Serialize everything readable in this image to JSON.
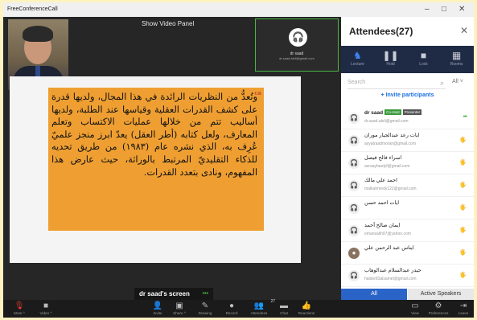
{
  "window": {
    "title": "FreeConferenceCall",
    "minimize": "–",
    "maximize": "□",
    "close": "✕"
  },
  "stage": {
    "show_video_panel": "Show Video Panel",
    "participant_tile": {
      "name": "dr saad",
      "email": "dr.saad.aleli@gmail.com"
    },
    "slide_corner_mark": "GR",
    "slide_text": "وتُعدُّ من النظريات الرائدة في هذا المجال، ولديها قدرة على كشف القدرات العقلية وقياسها عند الطلبة، ولديها أساليب تتم من خلالها عمليات الاكتساب وتعلم المعارف، ولعل كتابه (أطر العقل) يعدّ ابرز منجز علميّ عُرِف به، الذي نشره عام (١٩٨٣) من طريق تحديه للذكاء التقليديّ المرتبط بالوراثة، حيث عارض هذا المفهوم، ونادى بتعدد القدرات.",
    "screen_label": "dr saad's screen",
    "screen_indicator": "•••"
  },
  "sidebar": {
    "title": "Attendees(27)",
    "close": "✕",
    "tools": [
      {
        "label": "Lecture",
        "icon": "lecture-icon",
        "glyph": "♞"
      },
      {
        "label": "Hold",
        "icon": "pause-icon",
        "glyph": "❚❚"
      },
      {
        "label": "Lock",
        "icon": "lock-icon",
        "glyph": "■"
      },
      {
        "label": "Rooms",
        "icon": "grid-icon",
        "glyph": "▦"
      }
    ],
    "search_placeholder": "Search",
    "search_icon": "⌕",
    "filter": "All ˅",
    "invite": "+ Invite participants",
    "attendees": [
      {
        "name": "dr saad",
        "email": "dr.saad.aleli@gmail.com",
        "cohost": "Co-Host",
        "presenter": "Presenter",
        "right": "•••",
        "photo": false
      },
      {
        "name": "ايات رعد عبدالجبار موران",
        "email": "ayyatraadmoran@gmail.com",
        "right": "🖐",
        "photo": false
      },
      {
        "name": "اسراء فالح فيصل",
        "email": "asraayfaadyf@gmail.com",
        "right": "🖐",
        "photo": false
      },
      {
        "name": "احمد علي مالك",
        "email": "malkahmedy122@gmail.com",
        "right": "🖐",
        "photo": false
      },
      {
        "name": "ايات احمد حسن",
        "email": "",
        "right": "🖐",
        "photo": false
      },
      {
        "name": "ايمان صالح أحمد",
        "email": "emansalih97@yahoo.com",
        "right": "🖐",
        "photo": false
      },
      {
        "name": "ايناس عبد الرحمن علي",
        "email": "",
        "right": "🖐",
        "photo": true
      },
      {
        "name": "حيدر عبدالسلام عبدالوهاب",
        "email": "haider83alsamel@gmail.com",
        "right": "🖐",
        "photo": false
      },
      {
        "name": "...",
        "email": "",
        "right": "🖐",
        "photo": false
      }
    ],
    "tab_all": "All",
    "tab_active": "Active Speakers"
  },
  "bottombar": {
    "left": [
      {
        "label": "Mute ^",
        "icon": "microphone-icon",
        "glyph": "🎙"
      },
      {
        "label": "Video ^",
        "icon": "camera-icon",
        "glyph": "■"
      }
    ],
    "center": [
      {
        "label": "Invite",
        "icon": "invite-icon",
        "glyph": "👤"
      },
      {
        "label": "Share ^",
        "icon": "share-icon",
        "glyph": "▣"
      },
      {
        "label": "Drawing",
        "icon": "pencil-icon",
        "glyph": "✎"
      },
      {
        "label": "Record",
        "icon": "record-icon",
        "glyph": "●"
      },
      {
        "label": "Attendees",
        "icon": "attendees-icon",
        "glyph": "👥",
        "count": "27"
      },
      {
        "label": "Chat",
        "icon": "chat-icon",
        "glyph": "▬"
      },
      {
        "label": "Reactions",
        "icon": "thumbs-up-icon",
        "glyph": "👍"
      }
    ],
    "right": [
      {
        "label": "View",
        "icon": "view-icon",
        "glyph": "▭"
      },
      {
        "label": "Preferences",
        "icon": "gear-icon",
        "glyph": "⚙"
      },
      {
        "label": "Leave",
        "icon": "leave-icon",
        "glyph": "⇥"
      }
    ]
  }
}
